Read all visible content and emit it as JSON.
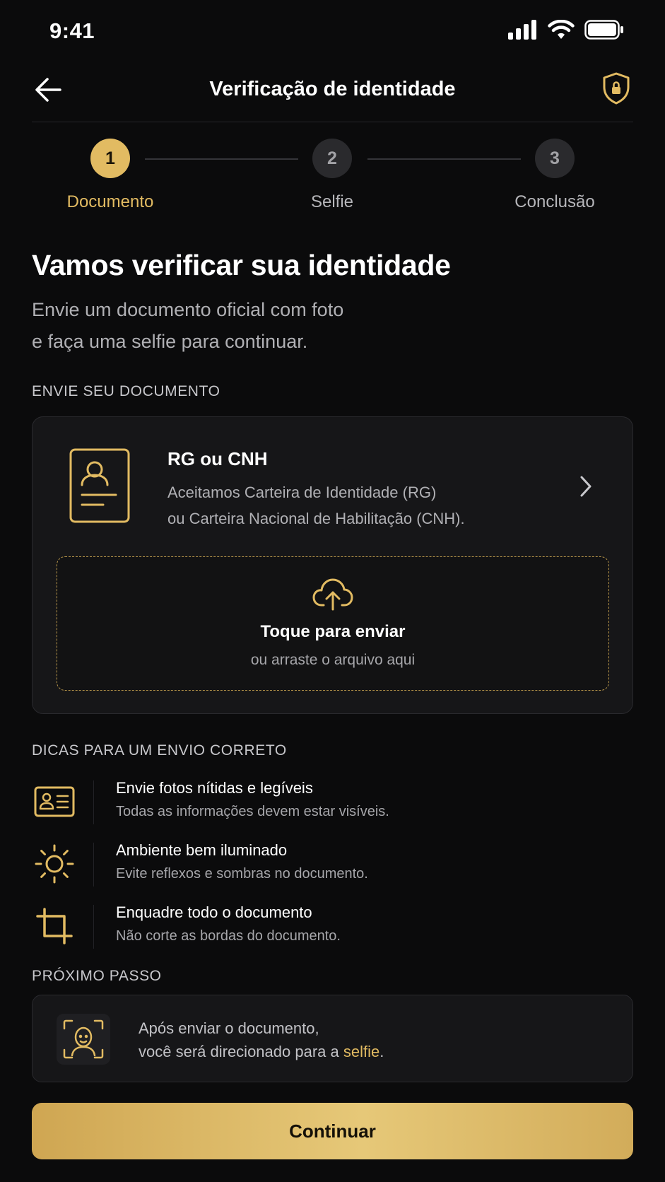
{
  "status_bar": {
    "time": "9:41"
  },
  "header": {
    "title": "Verificação de identidade"
  },
  "stepper": {
    "steps": [
      {
        "number": "1",
        "label": "Documento",
        "state": "active"
      },
      {
        "number": "2",
        "label": "Selfie",
        "state": "inactive"
      },
      {
        "number": "3",
        "label": "Conclusão",
        "state": "inactive"
      }
    ]
  },
  "intro": {
    "title": "Vamos verificar sua identidade",
    "subtitle_line1": "Envie um documento oficial com foto",
    "subtitle_line2": "e faça uma selfie para continuar."
  },
  "document_section": {
    "label": "ENVIE SEU DOCUMENTO",
    "card": {
      "title": "RG ou CNH",
      "desc_line1": "Aceitamos Carteira de Identidade (RG)",
      "desc_line2": "ou Carteira Nacional de Habilitação (CNH)."
    },
    "upload": {
      "title": "Toque para enviar",
      "subtitle": "ou arraste o arquivo aqui"
    }
  },
  "tips_section": {
    "label": "DICAS PARA UM ENVIO CORRETO",
    "tips": [
      {
        "icon": "id-card-icon",
        "title": "Envie fotos nítidas e legíveis",
        "desc": "Todas as informações devem estar visíveis."
      },
      {
        "icon": "sun-icon",
        "title": "Ambiente bem iluminado",
        "desc": "Evite reflexos e sombras no documento."
      },
      {
        "icon": "crop-icon",
        "title": "Enquadre todo o documento",
        "desc": "Não corte as bordas do documento."
      }
    ]
  },
  "next_step_section": {
    "label": "PRÓXIMO PASSO",
    "line1": "Após enviar o documento,",
    "line2_prefix": "você será direcionado para a ",
    "line2_link": "selfie",
    "line2_suffix": "."
  },
  "continue_label": "Continuar",
  "colors": {
    "accent": "#e2bb62",
    "background": "#0b0b0c",
    "card": "#161618"
  }
}
